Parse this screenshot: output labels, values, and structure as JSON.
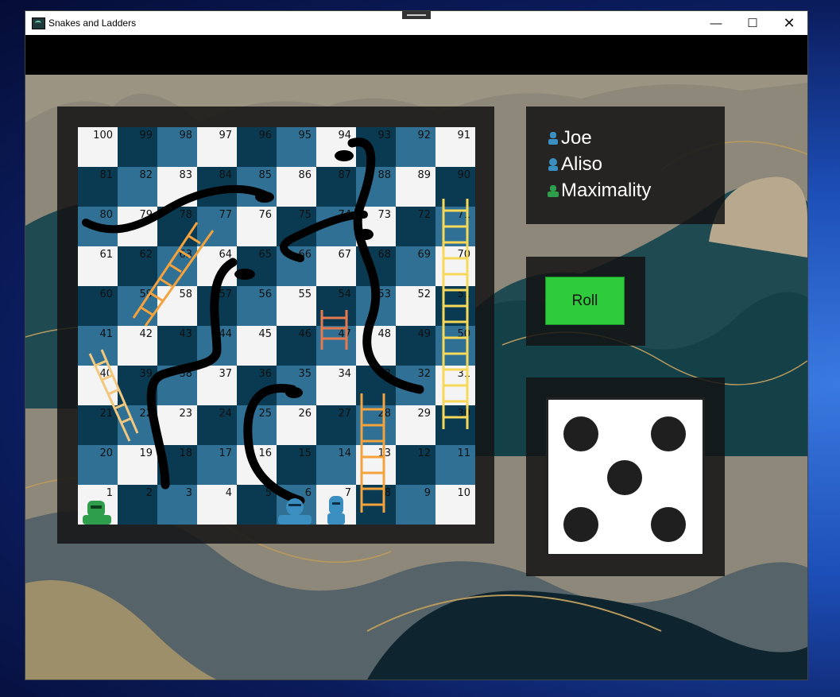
{
  "window": {
    "title": "Snakes and Ladders",
    "controls": {
      "minimize": "—",
      "maximize": "☐",
      "close": "✕"
    }
  },
  "board": {
    "cells": [
      100,
      99,
      98,
      97,
      96,
      95,
      94,
      93,
      92,
      91,
      81,
      82,
      83,
      84,
      85,
      86,
      87,
      88,
      89,
      90,
      80,
      79,
      78,
      77,
      76,
      75,
      74,
      73,
      72,
      71,
      61,
      62,
      63,
      64,
      65,
      66,
      67,
      68,
      69,
      70,
      60,
      59,
      58,
      57,
      56,
      55,
      54,
      53,
      52,
      51,
      41,
      42,
      43,
      44,
      45,
      46,
      47,
      48,
      49,
      50,
      40,
      39,
      38,
      37,
      36,
      35,
      34,
      33,
      32,
      31,
      21,
      22,
      23,
      24,
      25,
      26,
      27,
      28,
      29,
      30,
      20,
      19,
      18,
      17,
      16,
      15,
      14,
      13,
      12,
      11,
      1,
      2,
      3,
      4,
      5,
      6,
      7,
      8,
      9,
      10
    ],
    "colors": {
      "light": "#f4f4f4",
      "dark": "#0a3a52",
      "mid": "#2f7094"
    },
    "ladders": [
      {
        "from": 22,
        "to": 40
      },
      {
        "from": 59,
        "to": 84
      },
      {
        "from": 47,
        "to": 54
      },
      {
        "from": 8,
        "to": 33
      },
      {
        "from": 30,
        "to": 71
      }
    ],
    "snakes": [
      {
        "head": 94,
        "tail": 33
      },
      {
        "head": 85,
        "tail": 80
      },
      {
        "head": 73,
        "tail": 66
      },
      {
        "head": 64,
        "tail": 2
      },
      {
        "head": 35,
        "tail": 6
      }
    ],
    "tokens": [
      {
        "player": "Maximality",
        "square": 1,
        "color": "#2e9e4c"
      },
      {
        "player": "Aliso",
        "square": 6,
        "color": "#3a8ec0"
      },
      {
        "player": "Joe",
        "square": 7,
        "color": "#3a8ec0"
      }
    ]
  },
  "players": [
    {
      "name": "Joe",
      "icon": "player-avatar-icon",
      "color": "#3a8ec0"
    },
    {
      "name": "Aliso",
      "icon": "player-avatar-icon",
      "color": "#3a8ec0"
    },
    {
      "name": "Maximality",
      "icon": "player-avatar-icon",
      "color": "#2e9e4c"
    }
  ],
  "roll": {
    "label": "Roll",
    "color": "#2ecc3c"
  },
  "dice": {
    "value": 5
  }
}
